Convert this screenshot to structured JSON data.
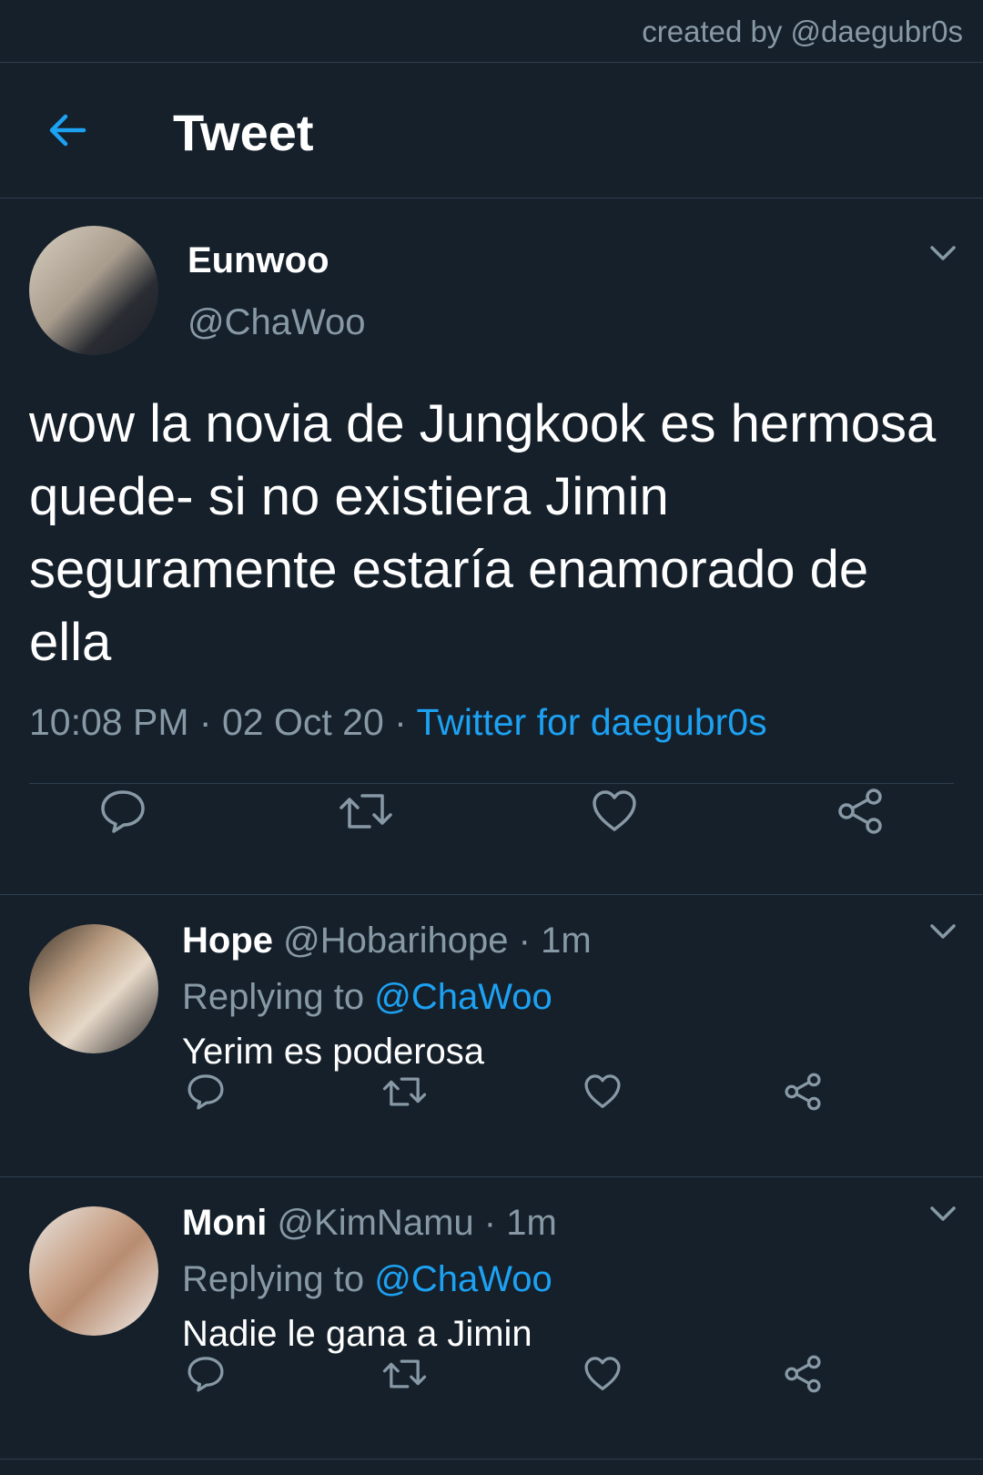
{
  "credit": "created by @daegubr0s",
  "header": {
    "title": "Tweet"
  },
  "tweet": {
    "author_name": "Eunwoo",
    "author_handle": "@ChaWoo",
    "text": "wow la novia de Jungkook es hermosa quede- si no existiera Jimin seguramente estaría enamorado de ella",
    "time": "10:08 PM",
    "sep1": "·",
    "date": "02 Oct 20",
    "sep2": "·",
    "source": "Twitter for daegubr0s"
  },
  "replies": [
    {
      "name": "Hope",
      "handle": "@Hobarihope",
      "time": "· 1m",
      "replying_prefix": "Replying to",
      "replying_to": "@ChaWoo",
      "text": "Yerim es poderosa"
    },
    {
      "name": "Moni",
      "handle": "@KimNamu",
      "time": "· 1m",
      "replying_prefix": "Replying to",
      "replying_to": "@ChaWoo",
      "text": "Nadie le gana a Jimin"
    }
  ],
  "colors": {
    "background": "#15202b",
    "accent": "#1da1f2",
    "secondary_text": "#8899a6",
    "divider": "#2f3d4c"
  },
  "icons": [
    "back-arrow-icon",
    "chevron-down-icon",
    "reply-icon",
    "retweet-icon",
    "like-icon",
    "share-icon"
  ]
}
